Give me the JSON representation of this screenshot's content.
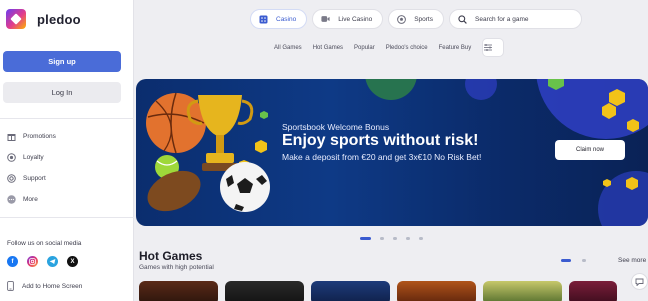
{
  "brand": {
    "name": "pledoo"
  },
  "auth": {
    "signup_label": "Sign up",
    "login_label": "Log In"
  },
  "sidebar": {
    "items": [
      {
        "label": "Promotions",
        "icon": "gift-icon"
      },
      {
        "label": "Loyalty",
        "icon": "loyalty-icon"
      },
      {
        "label": "Support",
        "icon": "support-icon"
      },
      {
        "label": "More",
        "icon": "more-icon"
      }
    ],
    "social_title": "Follow us on social media",
    "socials": [
      "facebook-icon",
      "instagram-icon",
      "telegram-icon",
      "x-icon"
    ],
    "add_home": "Add to Home Screen"
  },
  "topnav": {
    "tabs": [
      {
        "label": "Casino",
        "icon": "casino-icon",
        "active": true
      },
      {
        "label": "Live Casino",
        "icon": "video-icon",
        "active": false
      },
      {
        "label": "Sports",
        "icon": "ball-icon",
        "active": false
      }
    ],
    "search_label": "Search for a game"
  },
  "subnav": {
    "items": [
      "All Games",
      "Hot Games",
      "Popular",
      "Pledoo's choice",
      "Feature Buy"
    ]
  },
  "banner": {
    "eyebrow": "Sportsbook Welcome Bonus",
    "title": "Enjoy sports without risk!",
    "subtitle": "Make a deposit from €20 and get 3x€10 No Risk Bet!",
    "cta": "Claim now",
    "slides": 5,
    "active_slide": 0
  },
  "hot_games": {
    "title": "Hot Games",
    "subtitle": "Games with high potential",
    "see_more": "See more"
  },
  "colors": {
    "accent": "#4a6cd8",
    "banner_bg": "#0e3a86"
  }
}
